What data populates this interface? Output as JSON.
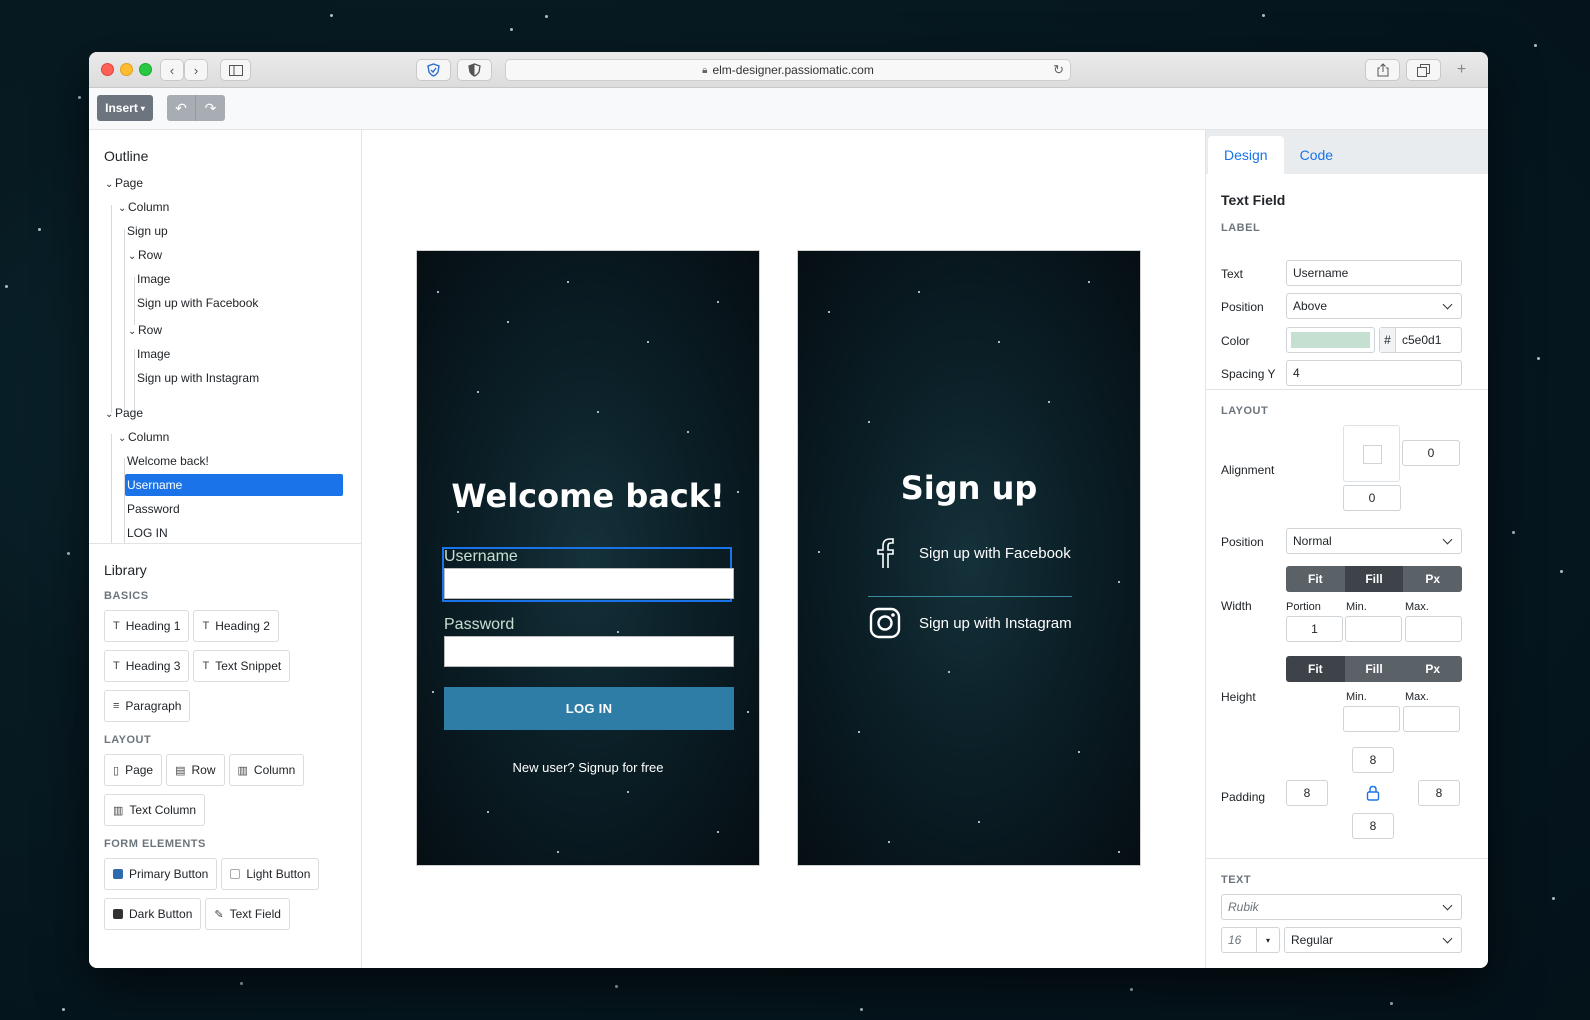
{
  "browser": {
    "url": "elm-designer.passiomatic.com"
  },
  "toolbar": {
    "insert_label": "Insert",
    "undo_icon": "↶",
    "redo_icon": "↷"
  },
  "outline": {
    "title": "Outline",
    "items": [
      {
        "label": "Page"
      },
      {
        "label": "Column"
      },
      {
        "label": "Sign up"
      },
      {
        "label": "Row"
      },
      {
        "label": "Image"
      },
      {
        "label": "Sign up with Facebook"
      },
      {
        "label": "Row"
      },
      {
        "label": "Image"
      },
      {
        "label": "Sign up with Instagram"
      },
      {
        "label": "Page"
      },
      {
        "label": "Column"
      },
      {
        "label": "Welcome back!"
      },
      {
        "label": "Username"
      },
      {
        "label": "Password"
      },
      {
        "label": "LOG IN"
      }
    ]
  },
  "library": {
    "title": "Library",
    "basics_caption": "BASICS",
    "basics": [
      "Heading 1",
      "Heading 2",
      "Heading 3",
      "Text Snippet",
      "Paragraph"
    ],
    "layout_caption": "LAYOUT",
    "layout": [
      "Page",
      "Row",
      "Column",
      "Text Column"
    ],
    "form_caption": "FORM ELEMENTS",
    "form": [
      "Primary Button",
      "Light Button",
      "Dark Button",
      "Text Field"
    ]
  },
  "login_page": {
    "heading": "Welcome back!",
    "username_label": "Username",
    "password_label": "Password",
    "login_button": "LOG IN",
    "signup_link": "New user? Signup for free"
  },
  "signup_page": {
    "heading": "Sign up",
    "facebook": "Sign up with Facebook",
    "instagram": "Sign up with Instagram"
  },
  "inspector": {
    "tabs": [
      "Design",
      "Code"
    ],
    "active_tab": "Design",
    "element_title": "Text Field",
    "label_caption": "LABEL",
    "text_label": "Text",
    "text_value": "Username",
    "position_label": "Position",
    "position_value": "Above",
    "color_label": "Color",
    "color_hash": "#",
    "color_value": "c5e0d1",
    "color_swatch": "#c5e0d1",
    "spacing_label": "Spacing Y",
    "spacing_value": "4",
    "layout_caption": "LAYOUT",
    "alignment_label": "Alignment",
    "align_x": "0",
    "align_y": "0",
    "layout_position_label": "Position",
    "layout_position_value": "Normal",
    "width_label": "Width",
    "width_modes": [
      "Fit",
      "Fill",
      "Px"
    ],
    "width_active": "Fill",
    "portion_label": "Portion",
    "min_label": "Min.",
    "max_label": "Max.",
    "portion_value": "1",
    "height_label": "Height",
    "height_modes": [
      "Fit",
      "Fill",
      "Px"
    ],
    "height_active": "Fit",
    "padding_label": "Padding",
    "padding_top": "8",
    "padding_left": "8",
    "padding_right": "8",
    "padding_bottom": "8",
    "text_caption": "TEXT",
    "font_family": "Rubik",
    "font_size": "16",
    "font_weight": "Regular"
  },
  "colors": {
    "accent": "#1a73e8",
    "primary_button": "#2e7da6",
    "label_color": "#c5e0d1"
  }
}
